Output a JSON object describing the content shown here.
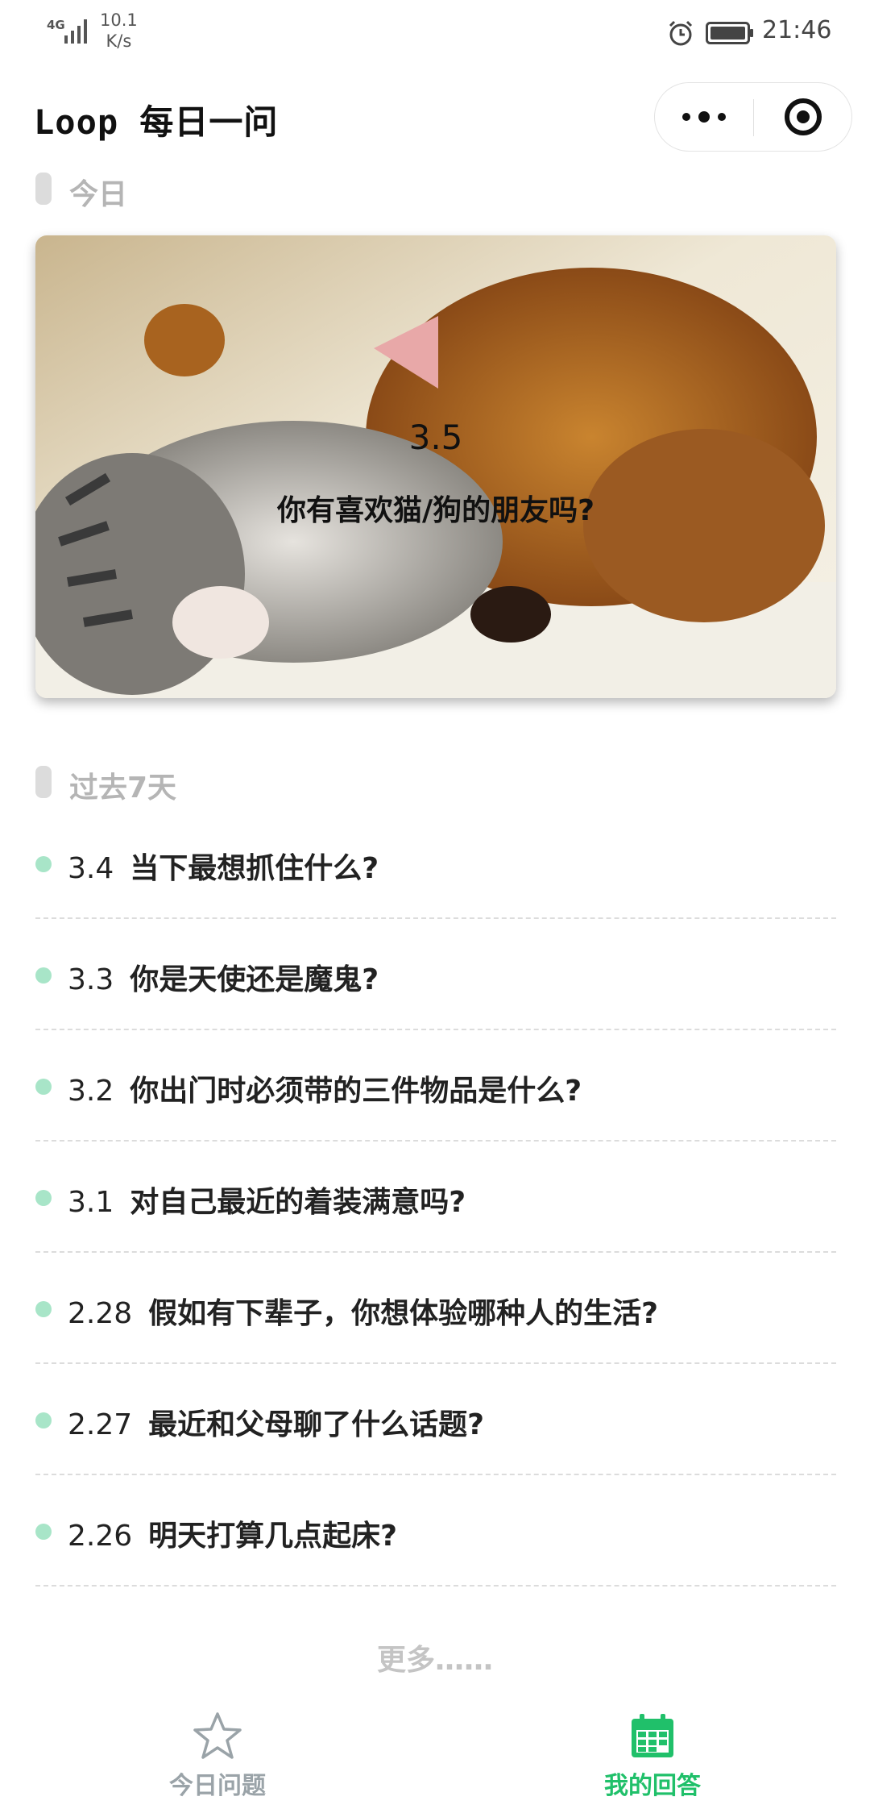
{
  "status_bar": {
    "network": "4G",
    "speed_value": "10.1",
    "speed_unit": "K/s",
    "time": "21:46"
  },
  "header": {
    "title": "Loop 每日一问"
  },
  "today": {
    "section_label": "今日",
    "date": "3.5",
    "question": "你有喜欢猫/狗的朋友吗?"
  },
  "past": {
    "section_label": "过去7天",
    "items": [
      {
        "date": "3.4",
        "question": "当下最想抓住什么?"
      },
      {
        "date": "3.3",
        "question": "你是天使还是魔鬼?"
      },
      {
        "date": "3.2",
        "question": "你出门时必须带的三件物品是什么?"
      },
      {
        "date": "3.1",
        "question": "对自己最近的着装满意吗?"
      },
      {
        "date": "2.28",
        "question": "假如有下辈子，你想体验哪种人的生活?"
      },
      {
        "date": "2.27",
        "question": "最近和父母聊了什么话题?"
      },
      {
        "date": "2.26",
        "question": "明天打算几点起床?"
      }
    ],
    "more_label": "更多……"
  },
  "tabs": {
    "today_label": "今日问题",
    "answers_label": "我的回答"
  },
  "colors": {
    "accent": "#20c06a",
    "dot": "#a8e5c8",
    "muted": "#b5b5b5"
  }
}
